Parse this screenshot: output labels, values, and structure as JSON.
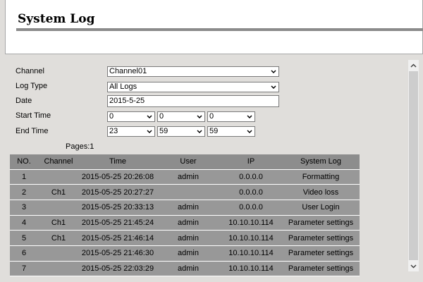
{
  "header": {
    "title": "System Log"
  },
  "form": {
    "channel_label": "Channel",
    "channel_value": "Channel01",
    "logtype_label": "Log Type",
    "logtype_value": "All Logs",
    "date_label": "Date",
    "date_value": "2015-5-25",
    "start_label": "Start Time",
    "start_h": "0",
    "start_m": "0",
    "start_s": "0",
    "end_label": "End Time",
    "end_h": "23",
    "end_m": "59",
    "end_s": "59"
  },
  "pages": "Pages:1",
  "table": {
    "headers": [
      "NO.",
      "Channel",
      "Time",
      "User",
      "IP",
      "System Log"
    ],
    "rows": [
      [
        "1",
        "",
        "2015-05-25 20:26:08",
        "admin",
        "0.0.0.0",
        "Formatting"
      ],
      [
        "2",
        "Ch1",
        "2015-05-25 20:27:27",
        "",
        "0.0.0.0",
        "Video loss"
      ],
      [
        "3",
        "",
        "2015-05-25 20:33:13",
        "admin",
        "0.0.0.0",
        "User Login"
      ],
      [
        "4",
        "Ch1",
        "2015-05-25 21:45:24",
        "admin",
        "10.10.10.114",
        "Parameter settings"
      ],
      [
        "5",
        "Ch1",
        "2015-05-25 21:46:14",
        "admin",
        "10.10.10.114",
        "Parameter settings"
      ],
      [
        "6",
        "",
        "2015-05-25 21:46:30",
        "admin",
        "10.10.10.114",
        "Parameter settings"
      ],
      [
        "7",
        "",
        "2015-05-25 22:03:29",
        "admin",
        "10.10.10.114",
        "Parameter settings"
      ]
    ]
  },
  "colors": {
    "header_row": "#8d8d8d",
    "data_row": "#989898",
    "background": "#e0dedb"
  }
}
